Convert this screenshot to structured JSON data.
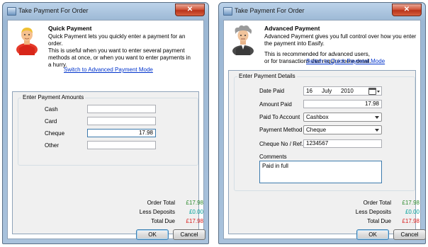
{
  "colors": {
    "green": "#2e8b2e",
    "teal": "#00a19a",
    "red": "#d9201f",
    "link": "#0033cc"
  },
  "left": {
    "title": "Take Payment For Order",
    "close": "✕",
    "header_title": "Quick Payment",
    "header_desc": "Quick Payment lets you quickly enter a payment for an order.",
    "header_note": "This is useful when you want to enter several payment methods at once, or when you want to enter payments in a hurry.",
    "switch_link": "Switch to Advanced Payment Mode",
    "group_label": "Enter Payment Amounts",
    "fields": [
      {
        "label": "Cash",
        "value": ""
      },
      {
        "label": "Card",
        "value": ""
      },
      {
        "label": "Cheque",
        "value": "17.98"
      },
      {
        "label": "Other",
        "value": ""
      }
    ],
    "totals": {
      "order_total_label": "Order Total",
      "order_total": "£17.98",
      "less_deposits_label": "Less Deposits",
      "less_deposits": "£0.00",
      "total_due_label": "Total Due",
      "total_due": "£17.98"
    },
    "ok": "OK",
    "cancel": "Cancel"
  },
  "right": {
    "title": "Take Payment For Order",
    "close": "✕",
    "header_title": "Advanced Payment",
    "header_desc": "Advanced Payment gives you full control over how you enter the payment into Easify.",
    "header_note": "This is recommended for advanced users, or for transactions that require more detail.",
    "switch_link": "Switch to Quick Payment Mode",
    "group_label": "Enter Payment Details",
    "date_label": "Date Paid",
    "date_day": "16",
    "date_month": "July",
    "date_year": "2010",
    "amount_label": "Amount Paid",
    "amount_value": "17.98",
    "account_label": "Paid To Account",
    "account_value": "Cashbox",
    "method_label": "Payment Method",
    "method_value": "Cheque",
    "ref_label": "Cheque No / Ref.",
    "ref_value": "1234567",
    "comments_label": "Comments",
    "comments_value": "Paid in full",
    "totals": {
      "order_total_label": "Order Total",
      "order_total": "£17.98",
      "less_deposits_label": "Less Deposits",
      "less_deposits": "£0.00",
      "total_due_label": "Total Due",
      "total_due": "£17.98"
    },
    "ok": "OK",
    "cancel": "Cancel"
  }
}
